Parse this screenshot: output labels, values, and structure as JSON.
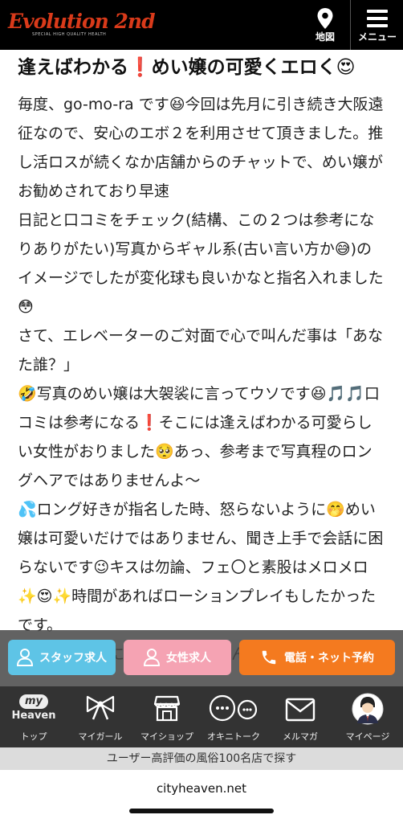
{
  "header": {
    "logo_text": "Evolution 2nd",
    "logo_sub": "SPECIAL HIGH QUALITY HEALTH",
    "map_label": "地図",
    "menu_label": "メニュー"
  },
  "article": {
    "title": "逢えばわかる❗️めい嬢の可愛くエロく😍",
    "body": "毎度、go-mo-ra です😆今回は先月に引き続き大阪遠征なので、安心のエボ２を利用させて頂きました。推し活ロスが続くなか店舗からのチャットで、めい嬢がお勧めされており早速\n日記と口コミをチェック(結構、この２つは参考になりありがたい)写真からギャル系(古い言い方か😅)のイメージでしたが変化球も良いかなと指名入れました😳\nさて、エレベーターのご対面で心で叫んだ事は「あなた誰？」\n🤣写真のめい嬢は大袈裟に言ってウソです😆🎵🎵口コミは参考になる❗️そこには逢えばわかる可愛らしい女性がおりました🥺あっ、参考まで写真程のロングヘアではありませんよ〜\n💦ロング好きが指名した時、怒らないように🤭めい嬢は可愛いだけではありません、聞き上手で会話に困らないです😉キスは勿論、フェ〇と素股はメロメロ✨😍✨時間があればローションプレイもしたかったです。\nエボ２は本当に良いキャストさんが在籍してます"
  },
  "actions": {
    "staff_label": "スタッフ求人",
    "female_label": "女性求人",
    "reserve_label": "電話・ネット予約"
  },
  "tabs": {
    "top_logo_top": "my",
    "top_logo_bottom": "Heaven",
    "top": "トップ",
    "mygirl": "マイガール",
    "myshop": "マイショップ",
    "talk": "オキニトーク",
    "mailmag": "メルマガ",
    "mypage": "マイページ"
  },
  "promo": "ユーザー高評価の風俗100名店で探す",
  "url": "cityheaven.net",
  "colors": {
    "header_bg": "#000000",
    "logo_red": "#d93a1a",
    "staff_btn": "#5ec4e6",
    "female_btn": "#f5a3b3",
    "reserve_btn": "#f47a1f",
    "tabbar_bg": "#333333"
  }
}
